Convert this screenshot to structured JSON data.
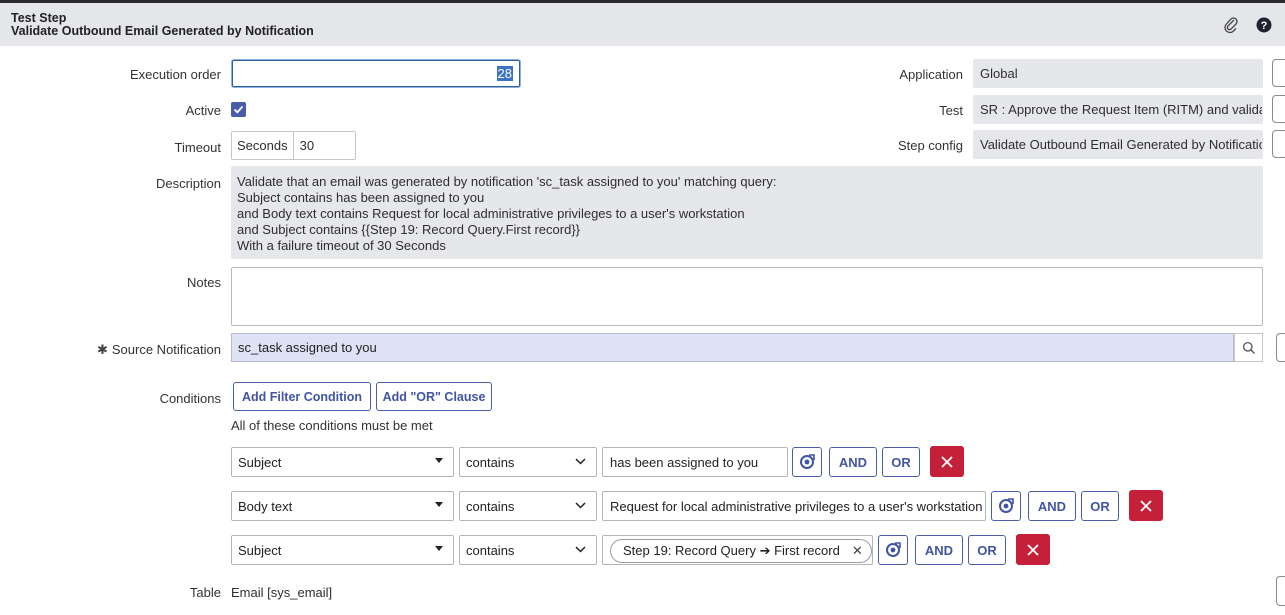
{
  "header": {
    "title": "Test Step",
    "subtitle": "Validate Outbound Email Generated by Notification",
    "attachment_icon": "paperclip-icon",
    "help_icon": "help-circle-icon"
  },
  "form": {
    "execution_order": {
      "label": "Execution order",
      "value": "28"
    },
    "active": {
      "label": "Active",
      "checked": true
    },
    "timeout": {
      "label": "Timeout",
      "unit": "Seconds",
      "value": "30"
    },
    "application": {
      "label": "Application",
      "value": "Global"
    },
    "test": {
      "label": "Test",
      "value": "SR : Approve the  Request Item (RITM) and validat"
    },
    "step_config": {
      "label": "Step config",
      "value": "Validate Outbound Email Generated by Notificatio"
    },
    "description": {
      "label": "Description",
      "lines": [
        "Validate that an email was generated by notification 'sc_task assigned to you' matching query:",
        "Subject contains has been assigned to you",
        "and Body text contains Request for local administrative privileges to a user's workstation",
        "and Subject contains {{Step 19: Record Query.First record}}",
        "With a failure timeout of 30 Seconds"
      ]
    },
    "notes": {
      "label": "Notes",
      "value": ""
    },
    "source_notification": {
      "label": "Source Notification",
      "required_mark": "✱",
      "value": "sc_task assigned to you"
    },
    "conditions": {
      "label": "Conditions",
      "add_filter_label": "Add Filter Condition",
      "add_or_label": "Add \"OR\" Clause",
      "hint": "All of these conditions must be met",
      "and_label": "AND",
      "or_label": "OR",
      "rows": [
        {
          "field": "Subject",
          "operator": "contains",
          "value": "has been assigned to you"
        },
        {
          "field": "Body text",
          "operator": "contains",
          "value": "Request for local administrative privileges to a user's workstation"
        },
        {
          "field": "Subject",
          "operator": "contains",
          "value": "Step 19: Record Query ➔ First record"
        }
      ]
    },
    "table": {
      "label": "Table",
      "value": "Email [sys_email]"
    }
  },
  "colors": {
    "accent": "#4054a6",
    "delete": "#c5203a",
    "readonly_bg": "#e6e7ea",
    "reference_bg": "#dfe1f4"
  }
}
